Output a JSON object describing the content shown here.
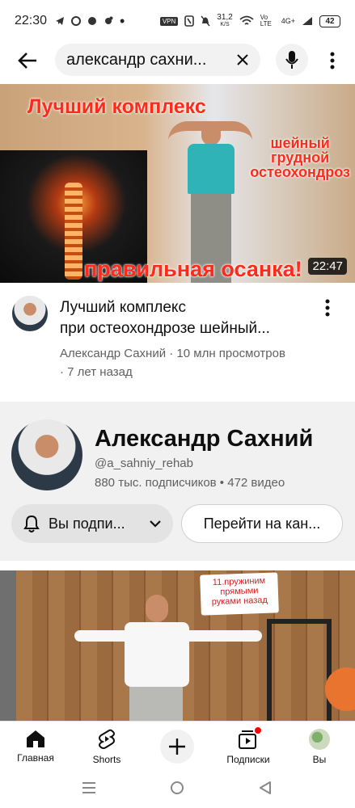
{
  "status_bar": {
    "time": "22:30",
    "vpn": "VPN",
    "net_speed": "31,2",
    "net_unit": "K/S",
    "volte": "Vo LTE",
    "network": "4G+",
    "battery": "42"
  },
  "header": {
    "search_query": "александр сахни..."
  },
  "video1": {
    "thumb_title": "Лучший комплекс",
    "thumb_right_line1": "шейный",
    "thumb_right_line2": "грудной",
    "thumb_right_line3": "остеохондроз",
    "thumb_bottom": "правильная осанка!",
    "duration": "22:47",
    "title_line1": "Лучший комплекс",
    "title_line2": "при остеохондрозе шейный...",
    "subtitle_line1": "Александр Сахний · 10 млн просмотров",
    "subtitle_line2": "· 7 лет назад"
  },
  "channel": {
    "name": "Александр Сахний",
    "handle": "@a_sahniy_rehab",
    "stats": "880 тыс. подписчиков • 472 видео",
    "subscribed_label": "Вы подпи...",
    "go_label": "Перейти на кан..."
  },
  "video2": {
    "bubble_line1": "11.пружиним",
    "bubble_line2": "прямыми",
    "bubble_line3": "руками назад"
  },
  "bottom_nav": {
    "home": "Главная",
    "shorts": "Shorts",
    "subscriptions": "Подписки",
    "you": "Вы"
  },
  "colors": {
    "accent_red": "#ff0000",
    "thumb_text_red": "#ff2a1a",
    "secondary_text": "#606060"
  }
}
